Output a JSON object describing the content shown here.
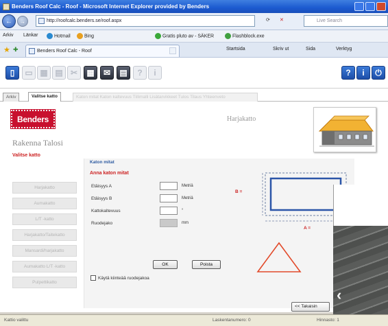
{
  "window": {
    "title": "Benders Roof Calc - Roof - Microsoft Internet Explorer provided by Benders"
  },
  "address": {
    "back_label": "←",
    "forward_label": "→",
    "url": "http://roofcalc.benders.se/roof.aspx",
    "search_placeholder": "Live Search"
  },
  "links": {
    "items": [
      "Arkiv",
      "Länkar",
      "Hotmail",
      "Bing",
      "Gratis pluto av - SÄKER",
      "Flashblock.exe"
    ]
  },
  "ie_tab": {
    "title": "Benders Roof Calc - Roof"
  },
  "commands": [
    "Startsida",
    "Skriv ut",
    "Sida",
    "Verktyg"
  ],
  "app_tabs": [
    {
      "label": "Arkiv",
      "state": "normal"
    },
    {
      "label": "Valitse katto",
      "state": "active"
    },
    {
      "label": "Katon mitat  Katon kaltevuus  Tiilimalli  Lisätarvikkeet  Tulos  Tilaus  Yhteenveto",
      "state": "disabled"
    }
  ],
  "sidebar": {
    "logo": "Benders",
    "subtitle": "Rakenna Talosi",
    "active_label": "Valitse katto",
    "buttons": [
      "Harjakatto",
      "Aumakatto",
      "L/T -katto",
      "Harjakatto/Taitekatto",
      "Mansardi/harjakatto",
      "Aumakatto L/T -katto",
      "Pulpettikatto"
    ]
  },
  "roof_type_title": "Harjakatto",
  "form": {
    "section_title": "Katon mitat",
    "subsection_title": "Anna katon mitat",
    "rows": [
      {
        "label": "Etäisyys A",
        "unit": "Metriä"
      },
      {
        "label": "Etäisyys B",
        "unit": "Metriä"
      },
      {
        "label": "Kattokaltevuus",
        "unit": "°"
      },
      {
        "label": "Ruodejako",
        "unit": "mm"
      }
    ],
    "ok_label": "OK",
    "reset_label": "Poista",
    "checkbox_label": "Käytä kiinteää ruodejakoa"
  },
  "diagram": {
    "label_b": "B =",
    "label_a": "A ="
  },
  "nav": {
    "prev_label": "<< Takaisin"
  },
  "status": {
    "left": "Kattio valittu",
    "center": "Laskentanumero: 0",
    "right": "Hinnasto: 1"
  },
  "colors": {
    "accent_blue": "#1d4ea8",
    "brand_red": "#c8102e",
    "diagram_blue": "#2b55a8",
    "triangle_red": "#e24a2a"
  }
}
